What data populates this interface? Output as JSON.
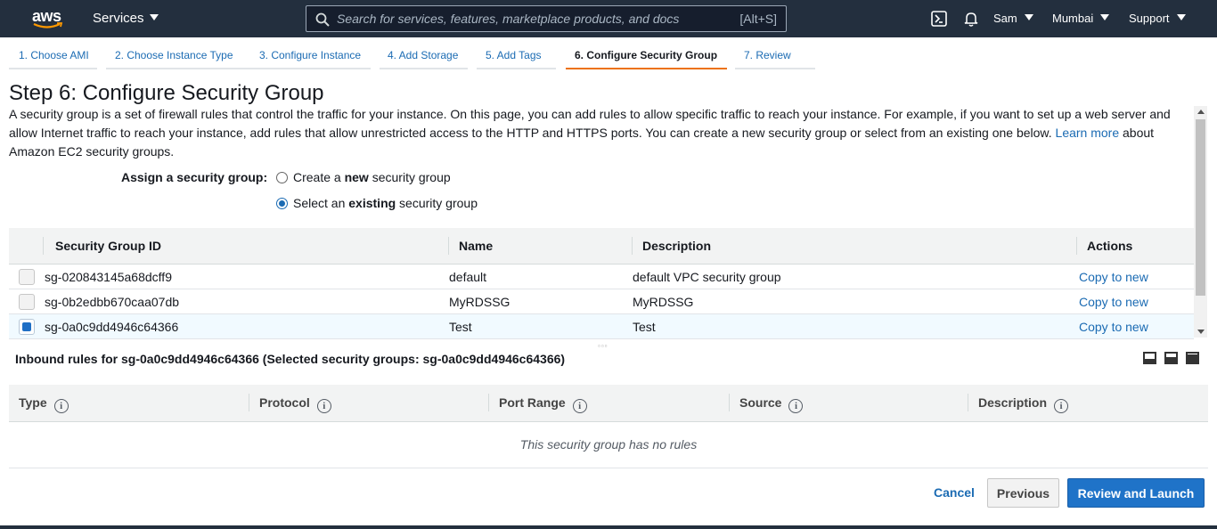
{
  "topnav": {
    "logo_text": "aws",
    "services_label": "Services",
    "search_placeholder": "Search for services, features, marketplace products, and docs",
    "search_shortcut": "[Alt+S]",
    "user_label": "Sam",
    "region_label": "Mumbai",
    "support_label": "Support"
  },
  "wizard": {
    "tabs": [
      {
        "label": "1. Choose AMI"
      },
      {
        "label": "2. Choose Instance Type"
      },
      {
        "label": "3. Configure Instance"
      },
      {
        "label": "4. Add Storage"
      },
      {
        "label": "5. Add Tags"
      },
      {
        "label": "6. Configure Security Group"
      },
      {
        "label": "7. Review"
      }
    ]
  },
  "page": {
    "title": "Step 6: Configure Security Group",
    "description": "A security group is a set of firewall rules that control the traffic for your instance. On this page, you can add rules to allow specific traffic to reach your instance. For example, if you want to set up a web server and allow Internet traffic to reach your instance, add rules that allow unrestricted access to the HTTP and HTTPS ports. You can create a new security group or select from an existing one below.",
    "learn_more": "Learn more",
    "description_tail": "about Amazon EC2 security groups."
  },
  "assign": {
    "label": "Assign a security group:",
    "option_new": {
      "pre": "Create a ",
      "bold": "new",
      "post": " security group"
    },
    "option_existing": {
      "pre": "Select an ",
      "bold": "existing",
      "post": " security group"
    },
    "selected": "existing"
  },
  "sg_table": {
    "headers": {
      "id": "Security Group ID",
      "name": "Name",
      "description": "Description",
      "actions": "Actions"
    },
    "rows": [
      {
        "id": "sg-020843145a68dcff9",
        "name": "default",
        "description": "default VPC security group",
        "action": "Copy to new",
        "checked": false
      },
      {
        "id": "sg-0b2edbb670caa07db",
        "name": "MyRDSSG",
        "description": "MyRDSSG",
        "action": "Copy to new",
        "checked": false
      },
      {
        "id": "sg-0a0c9dd4946c64366",
        "name": "Test",
        "description": "Test",
        "action": "Copy to new",
        "checked": true
      }
    ]
  },
  "inbound": {
    "title": "Inbound rules for sg-0a0c9dd4946c64366 (Selected security groups: sg-0a0c9dd4946c64366)",
    "headers": {
      "type": "Type",
      "protocol": "Protocol",
      "port_range": "Port Range",
      "source": "Source",
      "description": "Description"
    },
    "info_glyph": "i",
    "empty_message": "This security group has no rules"
  },
  "footer": {
    "cancel": "Cancel",
    "previous": "Previous",
    "review_launch": "Review and Launch"
  },
  "colors": {
    "nav_bg": "#232f3e",
    "link": "#1b6bb3",
    "active_tab": "#ec7211",
    "primary_button": "#1f73c8"
  }
}
